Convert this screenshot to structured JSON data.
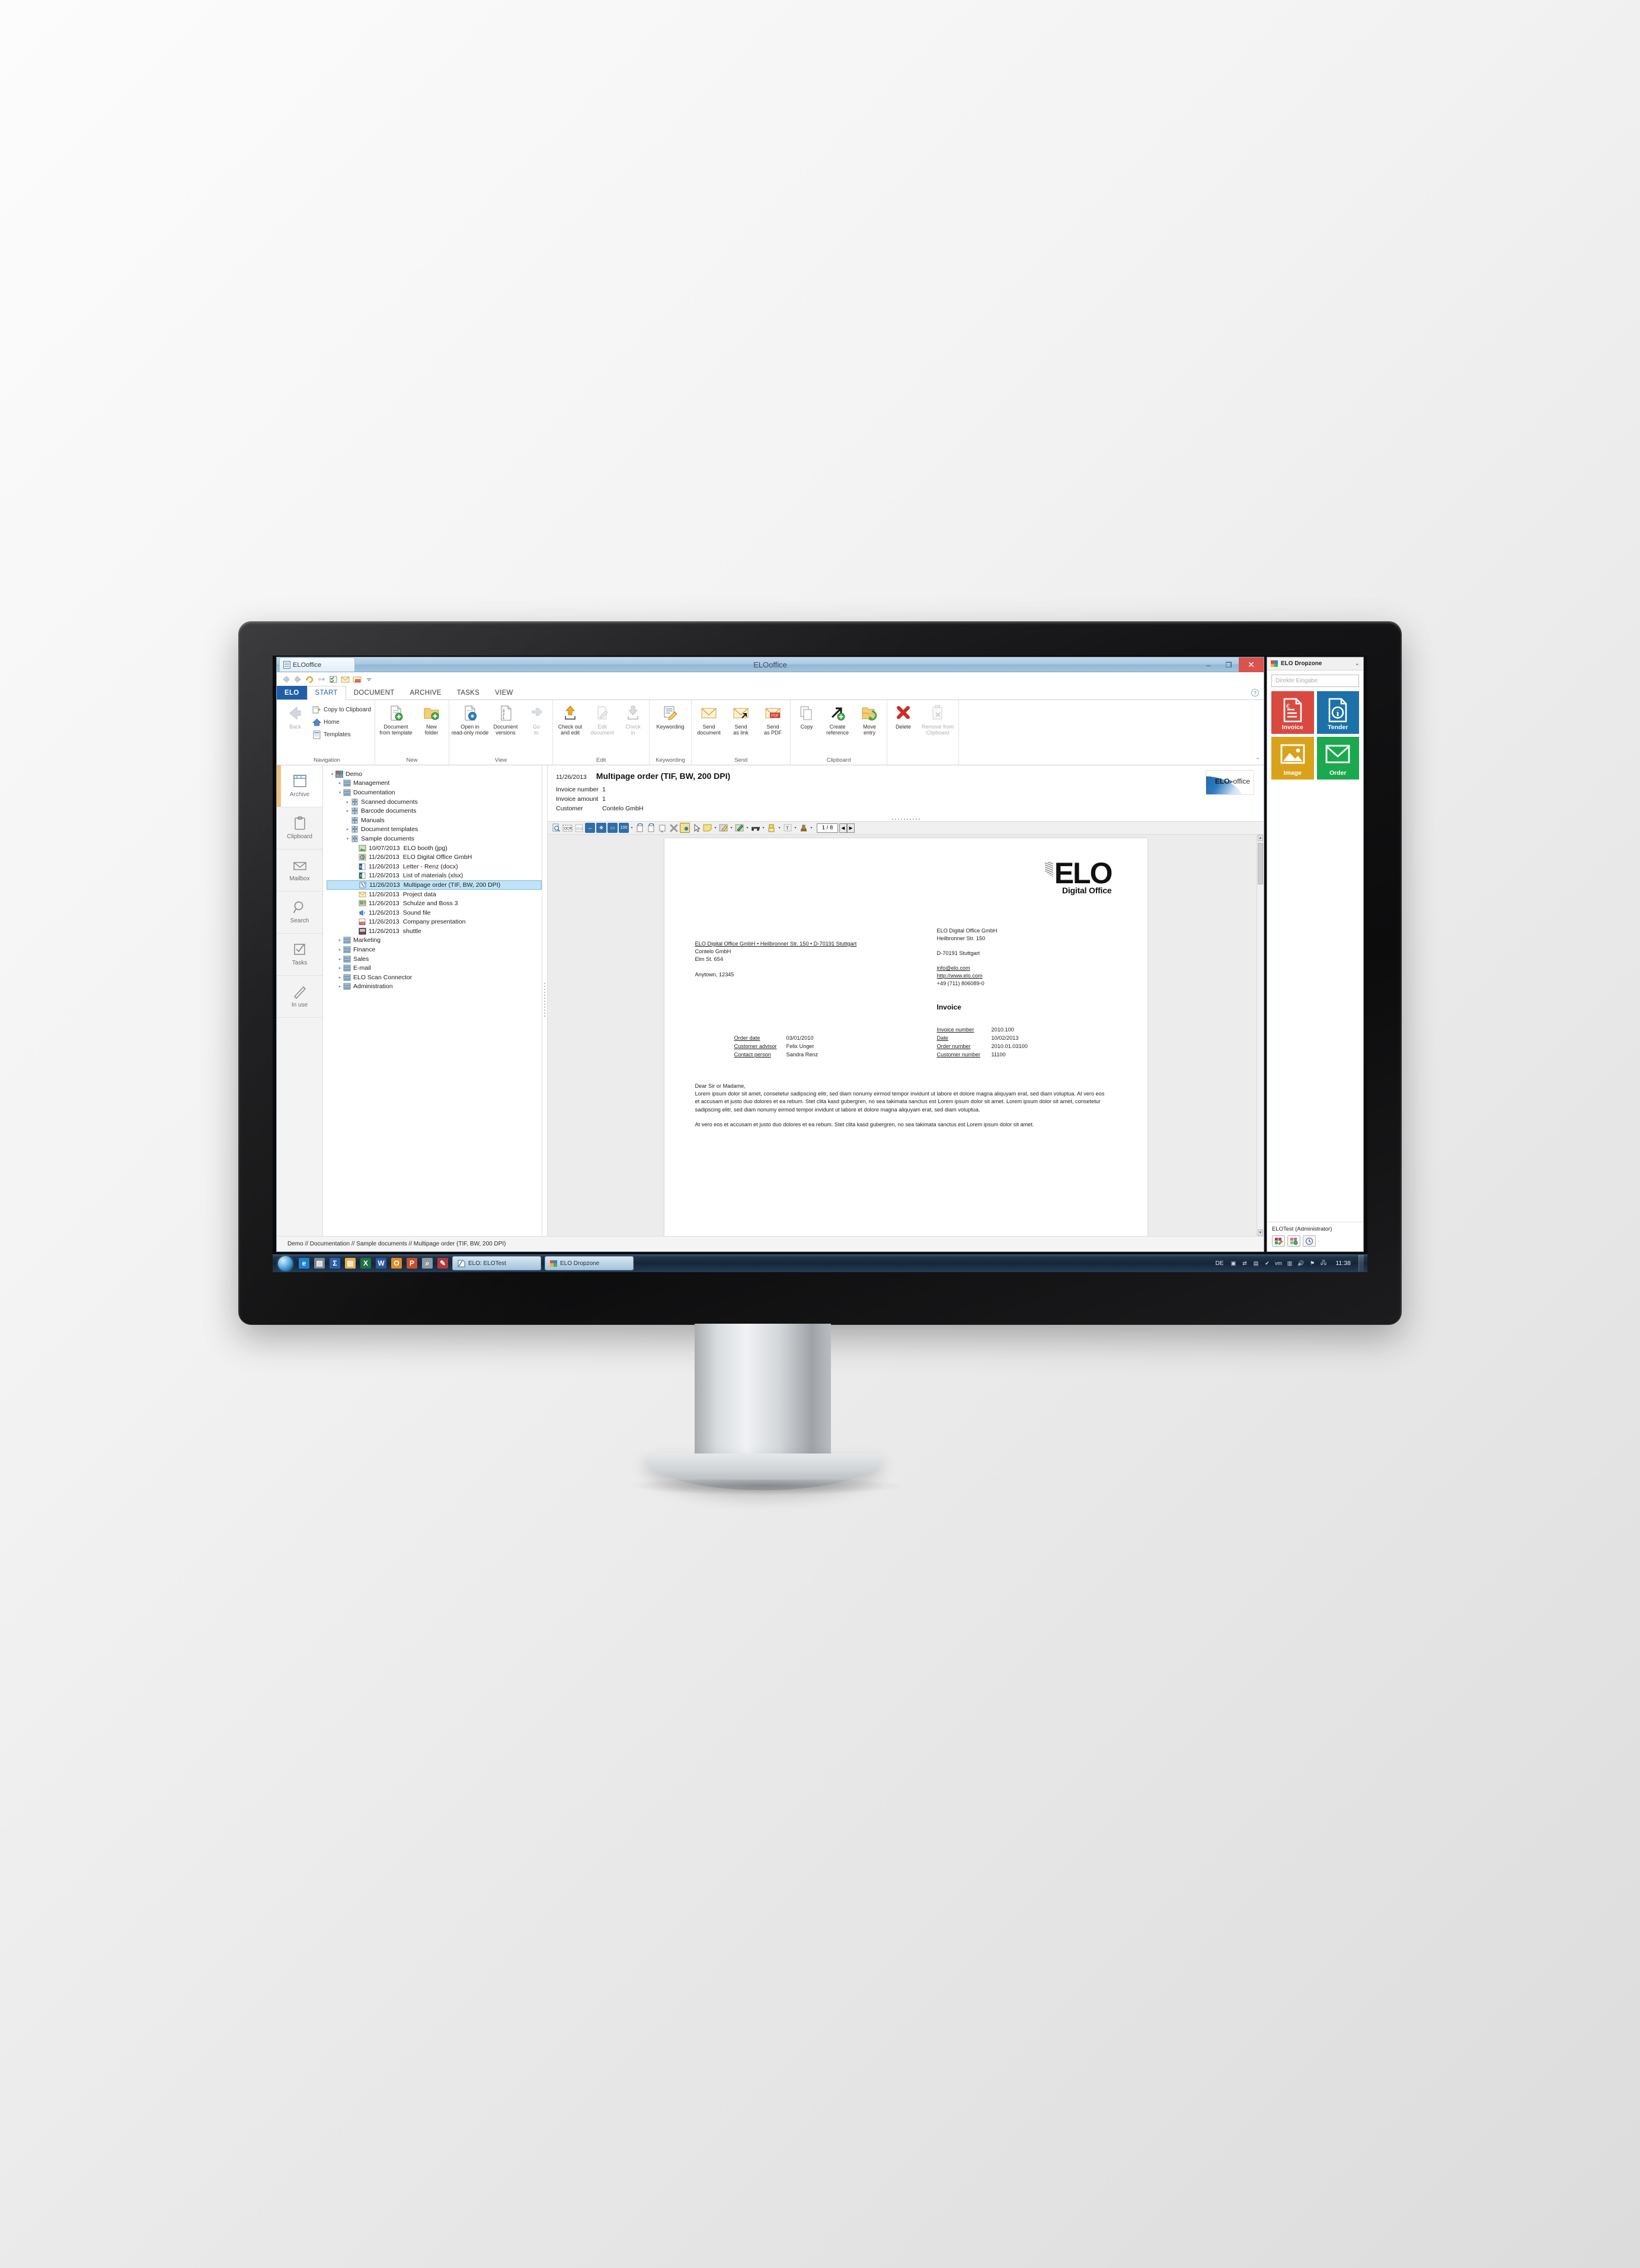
{
  "window": {
    "tab_caption": "ELOoffice",
    "title": "ELOoffice",
    "minimize": "–",
    "restore": "❐",
    "close": "✕"
  },
  "quick_access": [
    {
      "name": "back-arrow-icon",
      "glyph": "⬅"
    },
    {
      "name": "forward-arrow-icon",
      "glyph": "➡"
    },
    {
      "name": "refresh-icon",
      "glyph": "↻"
    },
    {
      "name": "link-icon",
      "glyph": "⊶"
    },
    {
      "name": "checklist-icon",
      "glyph": "☑"
    },
    {
      "name": "mail-icon",
      "glyph": "✉"
    },
    {
      "name": "pdf-icon",
      "glyph": "PDF"
    },
    {
      "name": "customize-qat-icon",
      "glyph": "▾"
    }
  ],
  "ribbon": {
    "tabs": [
      {
        "label": "ELO",
        "kind": "elo"
      },
      {
        "label": "START",
        "kind": "active"
      },
      {
        "label": "DOCUMENT",
        "kind": "normal"
      },
      {
        "label": "ARCHIVE",
        "kind": "normal"
      },
      {
        "label": "TASKS",
        "kind": "normal"
      },
      {
        "label": "VIEW",
        "kind": "normal"
      }
    ],
    "help_glyph": "?",
    "collapse_glyph": "⌃",
    "groups": [
      {
        "label": "Navigation",
        "big": [
          {
            "label": "Back",
            "icon": "back-arrow-icon",
            "disabled": true
          }
        ],
        "small": [
          {
            "label": "Copy to Clipboard",
            "icon": "copy-to-clipboard-icon"
          },
          {
            "label": "Home",
            "icon": "home-icon"
          },
          {
            "label": "Templates",
            "icon": "templates-icon"
          }
        ]
      },
      {
        "label": "New",
        "big": [
          {
            "label": "Document\nfrom template",
            "icon": "document-from-template-icon",
            "disabled": false
          },
          {
            "label": "New\nfolder",
            "icon": "new-folder-icon",
            "disabled": false
          }
        ],
        "small": []
      },
      {
        "label": "View",
        "big": [
          {
            "label": "Open in\nread-only mode",
            "icon": "open-read-only-icon",
            "disabled": false
          },
          {
            "label": "Document\nversions",
            "icon": "document-versions-icon",
            "disabled": false
          },
          {
            "label": "Go\nto",
            "icon": "go-to-icon",
            "disabled": true
          }
        ],
        "small": []
      },
      {
        "label": "Edit",
        "big": [
          {
            "label": "Check out\nand edit",
            "icon": "check-out-icon",
            "disabled": false
          },
          {
            "label": "Edit\ndocument",
            "icon": "edit-document-icon",
            "disabled": true
          },
          {
            "label": "Check\nin",
            "icon": "check-in-icon",
            "disabled": true
          }
        ],
        "small": []
      },
      {
        "label": "Keywording",
        "big": [
          {
            "label": "Keywording",
            "icon": "keywording-icon",
            "disabled": false
          }
        ],
        "small": []
      },
      {
        "label": "Send",
        "big": [
          {
            "label": "Send\ndocument",
            "icon": "send-document-icon",
            "disabled": false
          },
          {
            "label": "Send\nas link",
            "icon": "send-as-link-icon",
            "disabled": false
          },
          {
            "label": "Send\nas PDF",
            "icon": "send-as-pdf-icon",
            "disabled": false
          }
        ],
        "small": []
      },
      {
        "label": "Clipboard",
        "big": [
          {
            "label": "Copy",
            "icon": "copy-icon",
            "disabled": false
          },
          {
            "label": "Create\nreference",
            "icon": "create-reference-icon",
            "disabled": false
          },
          {
            "label": "Move\nentry",
            "icon": "move-entry-icon",
            "disabled": false
          }
        ],
        "small": []
      },
      {
        "label": "",
        "big": [
          {
            "label": "Delete",
            "icon": "delete-icon",
            "disabled": false
          },
          {
            "label": "Remove from\nClipboard",
            "icon": "remove-from-clipboard-icon",
            "disabled": true
          }
        ],
        "small": []
      }
    ]
  },
  "nav_sidebar": {
    "items": [
      {
        "label": "Archive",
        "icon": "archive-icon",
        "active": true
      },
      {
        "label": "Clipboard",
        "icon": "clipboard-icon",
        "active": false
      },
      {
        "label": "Mailbox",
        "icon": "mailbox-icon",
        "active": false
      },
      {
        "label": "Search",
        "icon": "search-icon",
        "active": false
      },
      {
        "label": "Tasks",
        "icon": "tasks-icon",
        "active": false
      },
      {
        "label": "In use",
        "icon": "in-use-pencil-icon",
        "active": false
      }
    ]
  },
  "tree": {
    "nodes": [
      {
        "indent": 0,
        "twist": "▾",
        "icon": "elo-root-icon",
        "date": "",
        "label": "Demo",
        "selected": false
      },
      {
        "indent": 1,
        "twist": "▸",
        "icon": "folder-cabinet-icon",
        "date": "",
        "label": "Management",
        "selected": false
      },
      {
        "indent": 1,
        "twist": "▾",
        "icon": "folder-cabinet-icon",
        "date": "",
        "label": "Documentation",
        "selected": false
      },
      {
        "indent": 2,
        "twist": "▸",
        "icon": "folder-binder-icon",
        "date": "",
        "label": "Scanned documents",
        "selected": false
      },
      {
        "indent": 2,
        "twist": "▸",
        "icon": "folder-binder-icon",
        "date": "",
        "label": "Barcode documents",
        "selected": false
      },
      {
        "indent": 2,
        "twist": "",
        "icon": "folder-binder-icon",
        "date": "",
        "label": "Manuals",
        "selected": false
      },
      {
        "indent": 2,
        "twist": "▸",
        "icon": "folder-binder-icon",
        "date": "",
        "label": "Document templates",
        "selected": false
      },
      {
        "indent": 2,
        "twist": "▾",
        "icon": "folder-binder-icon",
        "date": "",
        "label": "Sample documents",
        "selected": false
      },
      {
        "indent": 3,
        "twist": "",
        "icon": "image-file-icon",
        "date": "10/07/2013",
        "label": "ELO booth (jpg)",
        "selected": false
      },
      {
        "indent": 3,
        "twist": "",
        "icon": "web-file-icon",
        "date": "11/26/2013",
        "label": "ELO Digital Office GmbH",
        "selected": false
      },
      {
        "indent": 3,
        "twist": "",
        "icon": "word-file-icon",
        "date": "11/26/2013",
        "label": "Letter - Renz (docx)",
        "selected": false
      },
      {
        "indent": 3,
        "twist": "",
        "icon": "excel-file-icon",
        "date": "11/26/2013",
        "label": "List of materials (xlsx)",
        "selected": false
      },
      {
        "indent": 3,
        "twist": "",
        "icon": "tiff-file-icon",
        "date": "11/26/2013",
        "label": "Multipage order (TIF, BW, 200 DPI)",
        "selected": true
      },
      {
        "indent": 3,
        "twist": "",
        "icon": "mail-file-icon",
        "date": "11/26/2013",
        "label": "Project data",
        "selected": false
      },
      {
        "indent": 3,
        "twist": "",
        "icon": "presentation-file-icon",
        "date": "11/26/2013",
        "label": "Schulze and Boss 3",
        "selected": false
      },
      {
        "indent": 3,
        "twist": "",
        "icon": "sound-file-icon",
        "date": "11/26/2013",
        "label": "Sound file",
        "selected": false
      },
      {
        "indent": 3,
        "twist": "",
        "icon": "pdf-file-icon",
        "date": "11/26/2013",
        "label": "Company presentation",
        "selected": false
      },
      {
        "indent": 3,
        "twist": "",
        "icon": "video-file-icon",
        "date": "11/26/2013",
        "label": "shuttle",
        "selected": false
      },
      {
        "indent": 1,
        "twist": "▸",
        "icon": "folder-cabinet-icon",
        "date": "",
        "label": "Marketing",
        "selected": false
      },
      {
        "indent": 1,
        "twist": "▸",
        "icon": "folder-cabinet-icon",
        "date": "",
        "label": "Finance",
        "selected": false
      },
      {
        "indent": 1,
        "twist": "▸",
        "icon": "folder-cabinet-icon",
        "date": "",
        "label": "Sales",
        "selected": false
      },
      {
        "indent": 1,
        "twist": "▸",
        "icon": "folder-cabinet-icon",
        "date": "",
        "label": "E-mail",
        "selected": false
      },
      {
        "indent": 1,
        "twist": "▸",
        "icon": "folder-cabinet-icon",
        "date": "",
        "label": "ELO Scan Connector",
        "selected": false
      },
      {
        "indent": 1,
        "twist": "▸",
        "icon": "folder-cabinet-icon",
        "date": "",
        "label": "Administration",
        "selected": false
      }
    ]
  },
  "doc_header": {
    "date": "11/26/2013",
    "title": "Multipage order (TIF, BW, 200 DPI)",
    "fields": [
      {
        "key": "Invoice number",
        "value": "1"
      },
      {
        "key": "Invoice amount",
        "value": "1"
      },
      {
        "key": "Customer",
        "value": "Contelo GmbH"
      }
    ],
    "brand": {
      "part1": "ELO",
      "sep": "▸",
      "part2": "office"
    }
  },
  "doc_toolbar": {
    "buttons": [
      {
        "name": "zoom-search-icon",
        "glyph": "🔍"
      },
      {
        "name": "ocr-icon",
        "glyph": "OCR"
      },
      {
        "name": "ocr-clipboard-icon",
        "glyph": "OCR"
      },
      {
        "name": "fit-width-icon",
        "glyph": "↔"
      },
      {
        "name": "fit-page-icon",
        "glyph": "✥"
      },
      {
        "name": "select-area-icon",
        "glyph": "▭"
      },
      {
        "name": "zoom-100-icon",
        "glyph": "100"
      },
      {
        "name": "rotate-left-icon",
        "glyph": "⟲"
      },
      {
        "name": "rotate-right-icon",
        "glyph": "⟳"
      },
      {
        "name": "rotate-180-icon",
        "glyph": "⤵"
      },
      {
        "name": "delete-page-icon",
        "glyph": "✖"
      },
      {
        "name": "annotation-view-icon",
        "glyph": "◨"
      },
      {
        "name": "pointer-icon",
        "glyph": "↖"
      },
      {
        "name": "sticky-note-icon",
        "glyph": "▭"
      },
      {
        "name": "highlight-area-icon",
        "glyph": "▨"
      },
      {
        "name": "pen-icon",
        "glyph": "✎"
      },
      {
        "name": "stamp-line-icon",
        "glyph": "▰"
      },
      {
        "name": "marker-icon",
        "glyph": "▮"
      },
      {
        "name": "text-annotation-icon",
        "glyph": "T"
      },
      {
        "name": "stamp-icon",
        "glyph": "⬒"
      }
    ],
    "page_indicator": "1 / 8",
    "prev_glyph": "◀",
    "next_glyph": "▶"
  },
  "document": {
    "logo_main": "ELO",
    "logo_sub": "Digital Office",
    "sender_line": "ELO Digital Office GmbH • Heilbronner Str. 150 • D-70191 Stuttgart",
    "recipient": [
      "Contelo GmbH",
      "Elm St. 654",
      "",
      "Anytown, 12345"
    ],
    "company_block": [
      "ELO Digital Office GmbH",
      "Heilbronner Str. 150",
      "",
      "D-70191 Stuttgart",
      "",
      "info@elo.com",
      "http://www.elo.com",
      "+49 (711) 806089-0"
    ],
    "invoice_heading": "Invoice",
    "left_fields": [
      {
        "key": "Order date",
        "value": "03/01/2010"
      },
      {
        "key": "Customer advisor",
        "value": "Felix Unger"
      },
      {
        "key": "Contact person",
        "value": "Sandra Renz"
      }
    ],
    "right_fields": [
      {
        "key": "Invoice number",
        "value": "2010.100"
      },
      {
        "key": "Date",
        "value": "10/02/2013"
      },
      {
        "key": "Order number",
        "value": "2010.01.03100"
      },
      {
        "key": "Customer number",
        "value": "11100"
      }
    ],
    "salutation": "Dear Sir or Madame,",
    "paragraph1": "Lorem ipsum dolor sit amet, consetetur sadipscing elitr, sed diam nonumy eirmod tempor invidunt ut labore et dolore magna aliquyam erat, sed diam voluptua. At vero eos et accusam et justo duo dolores et ea rebum. Stet clita kasd gubergren, no sea takimata sanctus est Lorem ipsum dolor sit amet. Lorem ipsum dolor sit amet, consetetur sadipscing elitr, sed diam nonumy eirmod tempor invidunt ut labore et dolore magna aliquyam erat, sed diam voluptua.",
    "paragraph2": "At vero eos et accusam et justo duo dolores et ea rebum. Stet clita kasd gubergren, no sea takimata sanctus est Lorem ipsum dolor sit amet."
  },
  "statusbar": {
    "path": "Demo // Documentation // Sample documents // Multipage order (TIF, BW, 200 DPI)"
  },
  "dropzone": {
    "title": "ELO Dropzone",
    "chevron": "⌄",
    "input_placeholder": "Direkte Eingabe",
    "tiles": [
      {
        "label": "Invoice",
        "color": "#d9493f",
        "icon": "invoice-document-icon"
      },
      {
        "label": "Tender",
        "color": "#1c72a8",
        "icon": "info-document-icon"
      },
      {
        "label": "Image",
        "color": "#d9a21b",
        "icon": "picture-icon"
      },
      {
        "label": "Order",
        "color": "#1aa94e",
        "icon": "envelope-icon"
      }
    ],
    "user": "ELOTest   (Administrator)",
    "footer_buttons": [
      {
        "name": "edit-colors-icon",
        "glyph": "▦"
      },
      {
        "name": "filter-icon",
        "glyph": "▤"
      },
      {
        "name": "history-clock-icon",
        "glyph": "◷"
      }
    ]
  },
  "taskbar": {
    "start_label": "Start",
    "pinned": [
      {
        "name": "internet-explorer-icon",
        "glyph": "e",
        "color": "#1d7fd0"
      },
      {
        "name": "printer-icon",
        "glyph": "▤",
        "color": "#7d8a96"
      },
      {
        "name": "sigma-app-icon",
        "glyph": "Σ",
        "color": "#2b5fa8"
      },
      {
        "name": "explorer-folder-icon",
        "glyph": "▤",
        "color": "#e8b04b"
      },
      {
        "name": "excel-icon",
        "glyph": "X",
        "color": "#1f7244"
      },
      {
        "name": "word-icon",
        "glyph": "W",
        "color": "#2b579a"
      },
      {
        "name": "outlook-icon",
        "glyph": "O",
        "color": "#e08b26"
      },
      {
        "name": "powerpoint-icon",
        "glyph": "P",
        "color": "#c94f2c"
      },
      {
        "name": "magnifier-icon",
        "glyph": "⌕",
        "color": "#8b99a6"
      },
      {
        "name": "paint-icon",
        "glyph": "✎",
        "color": "#b03a3a"
      }
    ],
    "tasks": [
      {
        "label": "ELO: ELOTest",
        "icon": "elo-task-icon",
        "active": true
      },
      {
        "label": "ELO Dropzone",
        "icon": "dropzone-task-icon",
        "active": false
      }
    ],
    "tray_lang": "DE",
    "tray_icons": [
      {
        "name": "monitor-icon",
        "glyph": "▣"
      },
      {
        "name": "network-sync-icon",
        "glyph": "⇄"
      },
      {
        "name": "display-icon",
        "glyph": "▤"
      },
      {
        "name": "antivirus-shield-icon",
        "glyph": "✔"
      },
      {
        "name": "vm-icon",
        "glyph": "vm"
      },
      {
        "name": "keyboard-icon",
        "glyph": "▥"
      },
      {
        "name": "volume-icon",
        "glyph": "🔊"
      },
      {
        "name": "flag-action-center-icon",
        "glyph": "⚑"
      },
      {
        "name": "network-icon",
        "glyph": "🖧"
      }
    ],
    "clock": "11:38"
  }
}
